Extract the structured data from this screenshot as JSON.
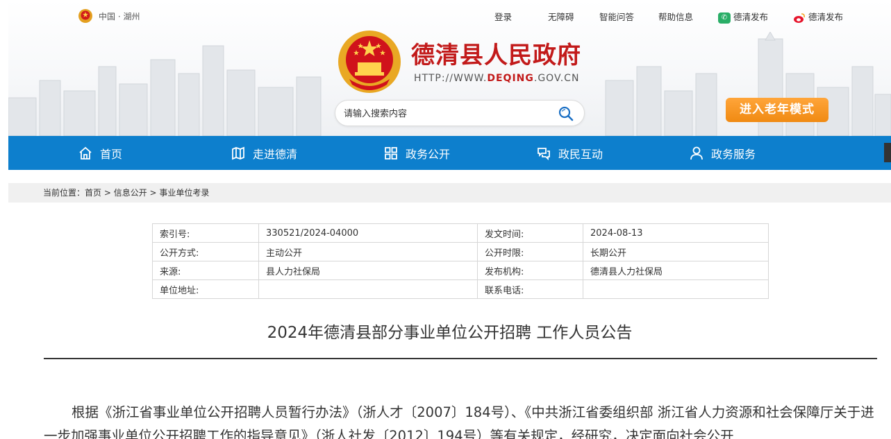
{
  "header": {
    "region": "中国 · 湖州",
    "links": {
      "login": "登录",
      "accessibility": "无障碍",
      "smart_qa": "智能问答",
      "help": "帮助信息",
      "wechat": "德清发布",
      "weibo": "德清发布"
    },
    "site_title": "德清县人民政府",
    "site_url_prefix": "HTTP://WWW.",
    "site_url_domain": "DEQING",
    "site_url_suffix": ".GOV.CN",
    "search_placeholder": "请输入搜索内容",
    "elder_mode_label": "进入老年模式"
  },
  "nav": {
    "items": [
      {
        "label": "首页",
        "icon": "home-icon"
      },
      {
        "label": "走进德清",
        "icon": "map-icon"
      },
      {
        "label": "政务公开",
        "icon": "grid-icon"
      },
      {
        "label": "政民互动",
        "icon": "interact-icon"
      },
      {
        "label": "政务服务",
        "icon": "user-icon"
      }
    ]
  },
  "breadcrumb": {
    "prefix": "当前位置：",
    "items": [
      "首页",
      "信息公开",
      "事业单位考录"
    ],
    "separator": " > "
  },
  "meta": {
    "rows": [
      {
        "k1": "索引号:",
        "v1": "330521/2024-04000",
        "k2": "发文时间:",
        "v2": "2024-08-13"
      },
      {
        "k1": "公开方式:",
        "v1": "主动公开",
        "k2": "公开时限:",
        "v2": "长期公开"
      },
      {
        "k1": "来源:",
        "v1": "县人力社保局",
        "k2": "发布机构:",
        "v2": "德清县人力社保局"
      },
      {
        "k1": "单位地址:",
        "v1": "",
        "k2": "联系电话:",
        "v2": ""
      }
    ]
  },
  "article": {
    "title": "2024年德清县部分事业单位公开招聘 工作人员公告",
    "body": "根据《浙江省事业单位公开招聘人员暂行办法》（浙人才〔2007〕184号）、《中共浙江省委组织部 浙江省人力资源和社会保障厅关于进一步加强事业单位公开招聘工作的指导意见》（浙人社发〔2012〕194号）等有关规定，经研究，决定面向社会公开"
  },
  "colors": {
    "brand_red": "#c21a1a",
    "nav_blue": "#0d7fcd",
    "elder_orange": "#f08a12"
  }
}
